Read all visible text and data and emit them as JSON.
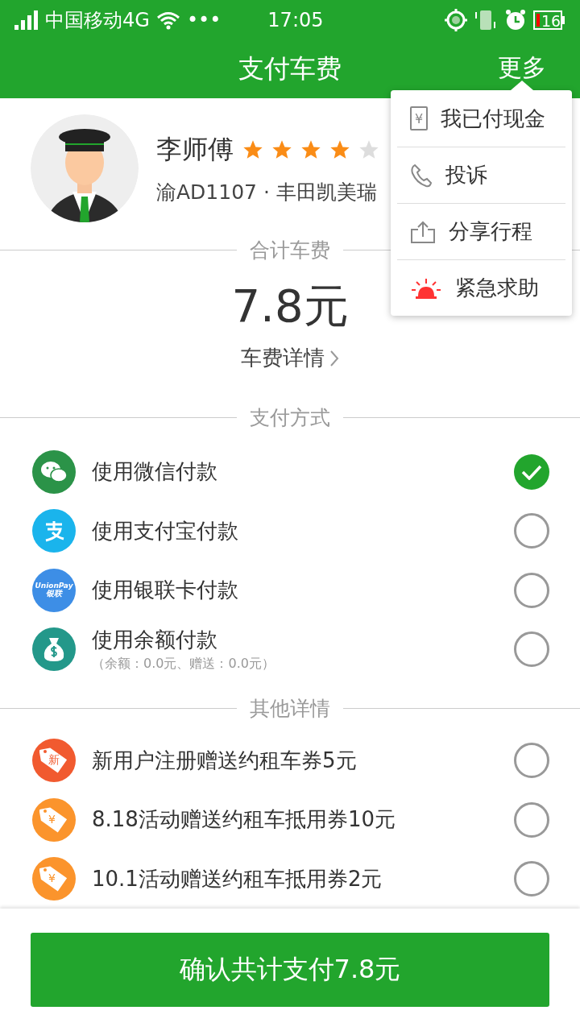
{
  "status_bar": {
    "carrier": "中国移动4G",
    "more": "•••",
    "time": "17:05",
    "battery": "16"
  },
  "header": {
    "title": "支付车费",
    "more": "更多"
  },
  "menu": {
    "items": [
      {
        "kind": "cash",
        "label": "我已付现金",
        "glyph": "¥"
      },
      {
        "kind": "phone",
        "label": "投诉"
      },
      {
        "kind": "share",
        "label": "分享行程"
      },
      {
        "kind": "alarm",
        "label": "紧急求助"
      }
    ]
  },
  "driver": {
    "name": "李师傅",
    "stars": 4,
    "plate": "渝AD1107",
    "separator": "·",
    "car": "丰田凯美瑞"
  },
  "fare": {
    "section": "合计车费",
    "amount": "7.8元",
    "details": "车费详情"
  },
  "payment": {
    "section": "支付方式",
    "methods": [
      {
        "kind": "wechat",
        "label": "使用微信付款",
        "selected": true
      },
      {
        "kind": "alipay",
        "label": "使用支付宝付款",
        "selected": false
      },
      {
        "kind": "unionpay",
        "label": "使用银联卡付款",
        "logo": "UnionPay",
        "logo_cn": "银联",
        "selected": false
      },
      {
        "kind": "balance",
        "label": "使用余额付款",
        "note": "（余额：0.0元、赠送：0.0元）",
        "selected": false
      }
    ]
  },
  "other": {
    "section": "其他详情",
    "coupons": [
      {
        "label": "新用户注册赠送约租车券5元",
        "badge": "新",
        "color": "#f15a2f",
        "selected": false
      },
      {
        "label": "8.18活动赠送约租车抵用券10元",
        "badge": "¥",
        "color": "#fb942c",
        "selected": false
      },
      {
        "label": "10.1活动赠送约租车抵用券2元",
        "badge": "¥",
        "color": "#fb942c",
        "selected": false
      }
    ]
  },
  "confirm": {
    "label": "确认共计支付7.8元"
  }
}
